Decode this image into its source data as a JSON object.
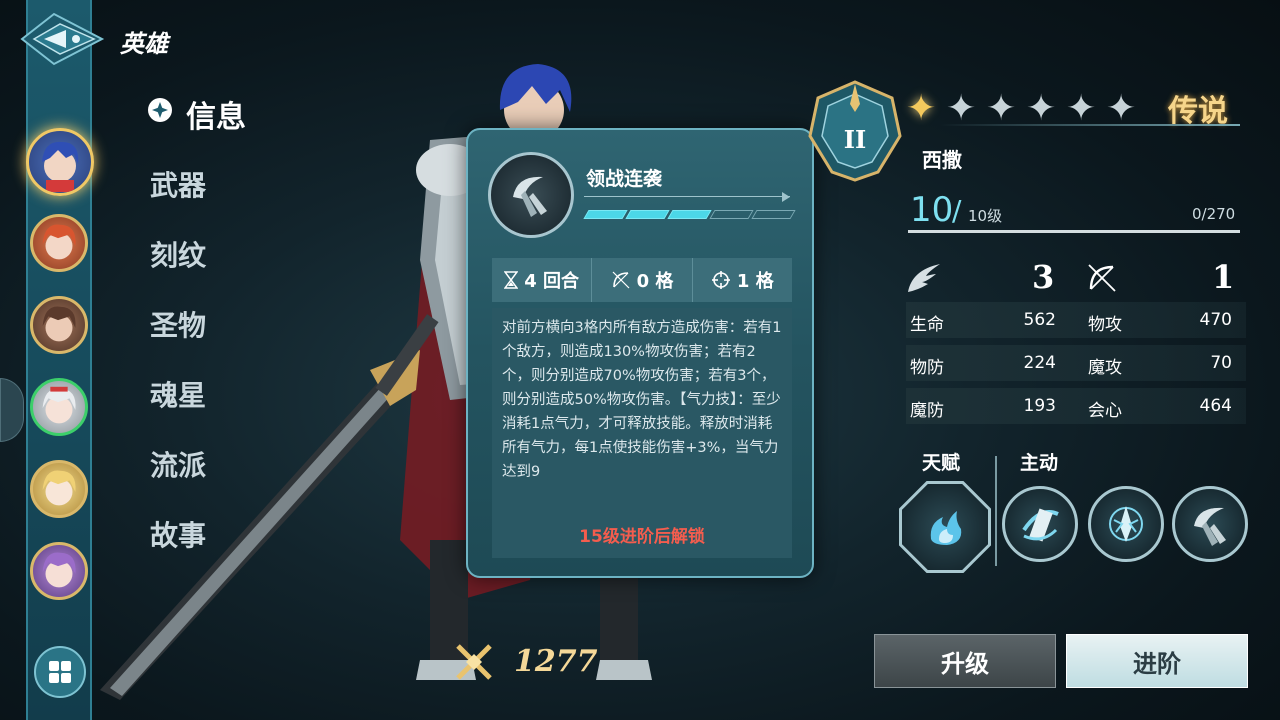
{
  "header": {
    "title": "英雄"
  },
  "nav": {
    "items": [
      {
        "label": "信息",
        "active": true
      },
      {
        "label": "武器"
      },
      {
        "label": "刻纹"
      },
      {
        "label": "圣物"
      },
      {
        "label": "魂星"
      },
      {
        "label": "流派"
      },
      {
        "label": "故事"
      }
    ]
  },
  "skill_popup": {
    "name": "领战连袭",
    "progress_segments_filled": 3,
    "progress_segments_total": 5,
    "cooldown": "4 回合",
    "range": "0 格",
    "area": "1 格",
    "description": "对前方横向3格内所有敌方造成伤害：若有1个敌方，则造成130%物攻伤害；若有2个，则分别造成70%物攻伤害；若有3个，则分别造成50%物攻伤害。【气力技】：至少消耗1点气力，才可释放技能。释放时消耗所有气力，每1点使技能伤害+3%，当气力达到9",
    "unlock_text": "15级进阶后解锁"
  },
  "hero": {
    "rank_numeral": "II",
    "stars_filled": 1,
    "stars_total": 6,
    "rarity": "传说",
    "name": "西撒",
    "level": "10",
    "level_slash": "/",
    "level_max": "10级",
    "exp": "0/270",
    "move_value": "3",
    "attack_range_value": "1",
    "power": "1277"
  },
  "attributes": [
    {
      "left_label": "生命",
      "left_value": "562",
      "right_label": "物攻",
      "right_value": "470"
    },
    {
      "left_label": "物防",
      "left_value": "224",
      "right_label": "魔攻",
      "right_value": "70"
    },
    {
      "left_label": "魔防",
      "left_value": "193",
      "right_label": "会心",
      "right_value": "464"
    }
  ],
  "skills": {
    "talent_label": "天赋",
    "active_label": "主动"
  },
  "buttons": {
    "upgrade": "升级",
    "advance": "进阶"
  },
  "colors": {
    "accent_cyan": "#4cd7e8",
    "gold": "#f4c95d",
    "warning_red": "#f45d4e"
  }
}
